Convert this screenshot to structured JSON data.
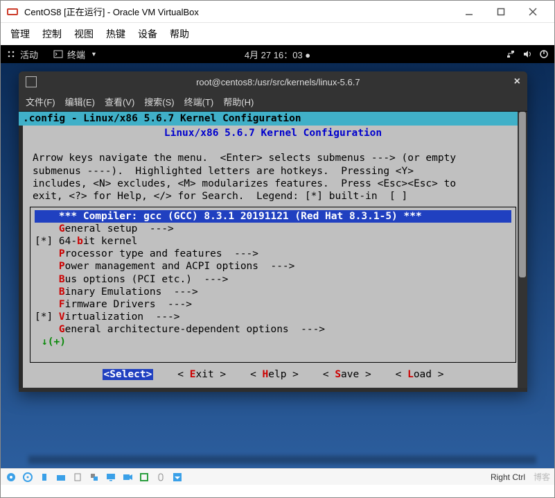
{
  "vbox": {
    "title": "CentOS8 [正在运行] - Oracle VM VirtualBox",
    "menu": [
      "管理",
      "控制",
      "视图",
      "热键",
      "设备",
      "帮助"
    ],
    "status": {
      "hostkey_label": "Right Ctrl",
      "icons": [
        "disk-icon",
        "optical-icon",
        "usb-icon",
        "shared-folder-icon",
        "audio-icon",
        "net-icon",
        "display-icon",
        "record-icon",
        "cpu-icon",
        "mouse-icon",
        "arrow-down-icon"
      ]
    }
  },
  "gnome": {
    "activities": "活动",
    "app": "终端",
    "clock": "4月 27  16：03",
    "tray": [
      "network-icon",
      "volume-icon",
      "power-icon"
    ]
  },
  "terminal": {
    "title": "root@centos8:/usr/src/kernels/linux-5.6.7",
    "menu": [
      "文件(F)",
      "编辑(E)",
      "查看(V)",
      "搜索(S)",
      "终端(T)",
      "帮助(H)"
    ]
  },
  "menuconfig": {
    "config_line": ".config - Linux/x86 5.6.7 Kernel Configuration",
    "box_title": "Linux/x86 5.6.7 Kernel Configuration",
    "help_lines": [
      "Arrow keys navigate the menu.  <Enter> selects submenus ---> (or empty",
      "submenus ----).  Highlighted letters are hotkeys.  Pressing <Y>",
      "includes, <N> excludes, <M> modularizes features.  Press <Esc><Esc> to",
      "exit, <?> for Help, </> for Search.  Legend: [*] built-in  [ ]"
    ],
    "items": [
      {
        "pre": "    ",
        "bold": true,
        "sel": true,
        "hk": "",
        "rest": "*** Compiler: gcc (GCC) 8.3.1 20191121 (Red Hat 8.3.1-5) ***"
      },
      {
        "pre": "    ",
        "hk": "G",
        "rest": "eneral setup  --->"
      },
      {
        "pre": "[*] 64-",
        "hk": "b",
        "rest": "it kernel"
      },
      {
        "pre": "    ",
        "hk": "P",
        "rest": "rocessor type and features  --->"
      },
      {
        "pre": "    ",
        "hk": "P",
        "rest": "ower management and ACPI options  --->"
      },
      {
        "pre": "    ",
        "hk": "B",
        "rest": "us options (PCI etc.)  --->"
      },
      {
        "pre": "    ",
        "hk": "B",
        "rest": "inary Emulations  --->"
      },
      {
        "pre": "    ",
        "hk": "F",
        "rest": "irmware Drivers  --->"
      },
      {
        "pre": "[*] ",
        "hk": "V",
        "rest": "irtualization  --->"
      },
      {
        "pre": "    ",
        "hk": "G",
        "rest": "eneral architecture-dependent options  --->"
      }
    ],
    "more": "↓(+)",
    "buttons": {
      "select": "<Select>",
      "exit_pre": "< ",
      "exit_k": "E",
      "exit_post": "xit >",
      "help_pre": "< ",
      "help_k": "H",
      "help_post": "elp >",
      "save_pre": "< ",
      "save_k": "S",
      "save_post": "ave >",
      "load_pre": "< ",
      "load_k": "L",
      "load_post": "oad >"
    }
  },
  "watermark": "博客"
}
